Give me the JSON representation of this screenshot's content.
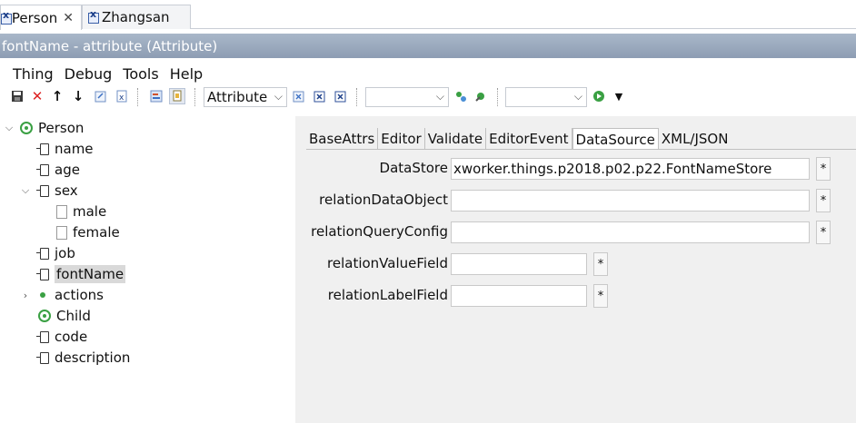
{
  "editor_tabs": [
    {
      "label": "Person",
      "active": true
    },
    {
      "label": "Zhangsan",
      "active": false
    }
  ],
  "title": "fontName - attribute  (Attribute)",
  "menu": [
    "Thing",
    "Debug",
    "Tools",
    "Help"
  ],
  "toolbar": {
    "type_combo_value": "Attribute",
    "combo2_value": "",
    "combo3_value": ""
  },
  "tree": [
    {
      "label": "Person",
      "icon": "class-icon",
      "twisty": "expanded"
    },
    {
      "label": "name",
      "icon": "attribute-icon"
    },
    {
      "label": "age",
      "icon": "attribute-icon"
    },
    {
      "label": "sex",
      "icon": "attribute-icon",
      "twisty": "expanded"
    },
    {
      "label": "male",
      "icon": "value-icon"
    },
    {
      "label": "female",
      "icon": "value-icon"
    },
    {
      "label": "job",
      "icon": "attribute-icon"
    },
    {
      "label": "fontName",
      "icon": "attribute-icon",
      "selected": true
    },
    {
      "label": "actions",
      "icon": "actions-icon",
      "twisty": "collapsed"
    },
    {
      "label": "Child",
      "icon": "class-icon"
    },
    {
      "label": "code",
      "icon": "attribute-icon"
    },
    {
      "label": "description",
      "icon": "attribute-icon"
    }
  ],
  "subtabs": [
    {
      "label": "BaseAttrs"
    },
    {
      "label": "Editor"
    },
    {
      "label": "Validate"
    },
    {
      "label": "EditorEvent"
    },
    {
      "label": "DataSource",
      "active": true
    },
    {
      "label": "XML/JSON"
    }
  ],
  "fields": [
    {
      "label": "DataStore",
      "value": "xworker.things.p2018.p02.p22.FontNameStore",
      "star": "*"
    },
    {
      "label": "relationDataObject",
      "value": "",
      "star": "*"
    },
    {
      "label": "relationQueryConfig",
      "value": "",
      "star": "*"
    },
    {
      "label": "relationValueField",
      "value": "",
      "star": "*"
    },
    {
      "label": "relationLabelField",
      "value": "",
      "star": "*"
    }
  ],
  "colors": {
    "title_bar": "#97a6ba",
    "accent_green": "#3aa043",
    "panel_bg": "#f0f0f0"
  }
}
